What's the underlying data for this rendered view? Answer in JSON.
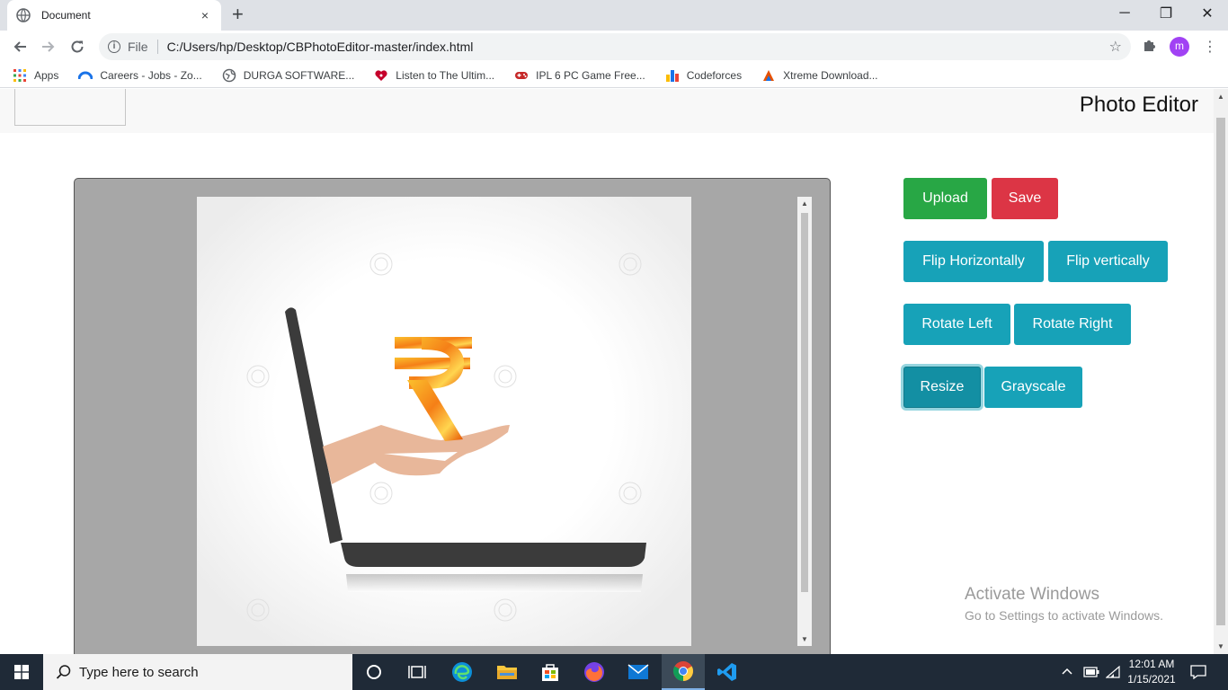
{
  "browser": {
    "tab_title": "Document",
    "tab_close": "×",
    "new_tab": "+",
    "window_controls": {
      "minimize": "─",
      "maximize": "❐",
      "close": "✕"
    },
    "address": {
      "scheme_label": "File",
      "url": "C:/Users/hp/Desktop/CBPhotoEditor-master/index.html"
    },
    "avatar_letter": "m",
    "bookmarks": [
      {
        "label": "Apps",
        "icon": "apps-grid-icon",
        "color": "#4285f4"
      },
      {
        "label": "Careers - Jobs - Zo...",
        "icon": "careers-icon",
        "color": "#1a73e8"
      },
      {
        "label": "DURGA SOFTWARE...",
        "icon": "globe-icon",
        "color": "#5f6368"
      },
      {
        "label": "Listen to The Ultim...",
        "icon": "iheart-icon",
        "color": "#c6002b"
      },
      {
        "label": "IPL 6 PC Game Free...",
        "icon": "gamepad-icon",
        "color": "#c62828"
      },
      {
        "label": "Codeforces",
        "icon": "codeforces-icon",
        "color": "#1a73e8"
      },
      {
        "label": "Xtreme Download...",
        "icon": "xtreme-icon",
        "color": "#e65100"
      }
    ]
  },
  "page": {
    "brand": "Photo Editor",
    "buttons": {
      "upload": "Upload",
      "save": "Save",
      "flip_horizontally": "Flip Horizontally",
      "flip_vertically": "Flip vertically",
      "rotate_left": "Rotate Left",
      "rotate_right": "Rotate Right",
      "resize": "Resize",
      "grayscale": "Grayscale"
    },
    "colors": {
      "success": "#28a745",
      "danger": "#dc3545",
      "info": "#17a2b8"
    },
    "image": {
      "description_icon": "rupee-hand-laptop-image"
    }
  },
  "watermark": {
    "line1": "Activate Windows",
    "line2": "Go to Settings to activate Windows."
  },
  "taskbar": {
    "search_placeholder": "Type here to search",
    "time": "12:01 AM",
    "date": "1/15/2021"
  }
}
